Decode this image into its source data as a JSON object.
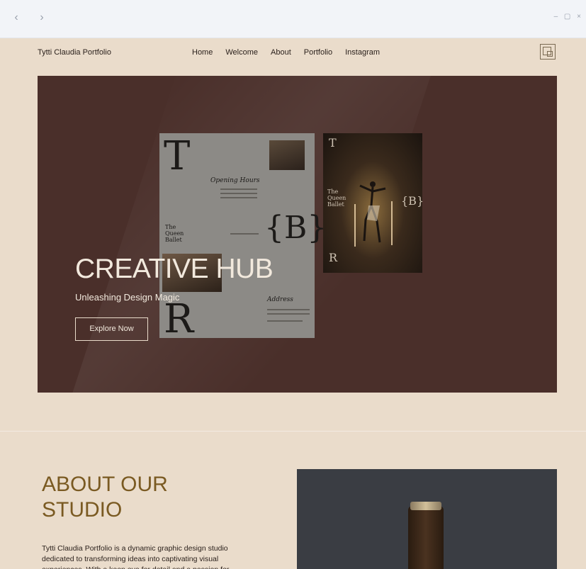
{
  "browser": {
    "back_icon": "chevron-left-icon",
    "forward_icon": "chevron-right-icon",
    "back_glyph": "‹",
    "forward_glyph": "›",
    "window_controls": "– ▢ ×"
  },
  "header": {
    "brand": "Tytti Claudia Portfolio",
    "nav": [
      "Home",
      "Welcome",
      "About",
      "Portfolio",
      "Instagram"
    ],
    "logo_icon": "square-logo-icon"
  },
  "hero": {
    "title": "CREATIVE HUB",
    "subtitle": "Unleashing Design Magic",
    "button": "Explore Now",
    "poster": {
      "letter_t": "T",
      "letter_r": "R",
      "brace_b": "{B}",
      "opening_hours": "Opening Hours",
      "address": "Address",
      "queen_ballet": "The Queen Ballet"
    },
    "photo": {
      "letter_t": "T",
      "letter_r": "R",
      "brace_b": "{B}",
      "queen_ballet": "The Queen Ballet"
    }
  },
  "about": {
    "title": "ABOUT OUR STUDIO",
    "text": "Tytti Claudia Portfolio is a dynamic graphic design studio dedicated to transforming ideas into captivating visual experiences. With a keen eye for detail and a passion for"
  },
  "colors": {
    "hero_bg": "#4a2f2a",
    "page_bg": "#eadccb",
    "accent": "#7a5a22"
  }
}
